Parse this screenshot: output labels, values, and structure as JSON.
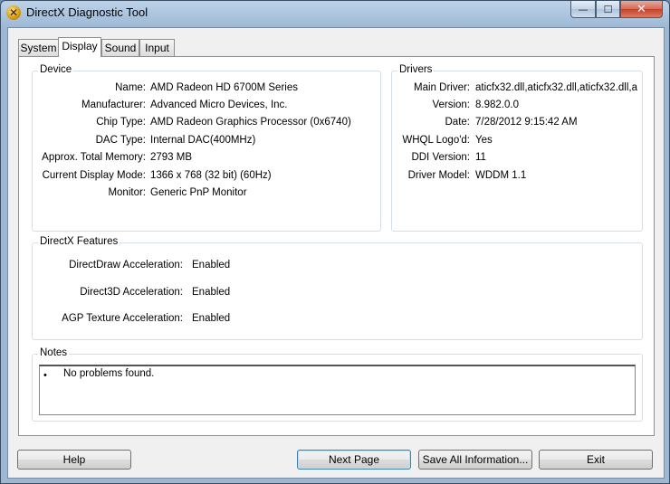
{
  "window": {
    "title": "DirectX Diagnostic Tool"
  },
  "tabs": [
    {
      "label": "System"
    },
    {
      "label": "Display"
    },
    {
      "label": "Sound"
    },
    {
      "label": "Input"
    }
  ],
  "active_tab": "Display",
  "device": {
    "title": "Device",
    "fields": [
      {
        "label": "Name:",
        "value": "AMD Radeon HD 6700M Series"
      },
      {
        "label": "Manufacturer:",
        "value": "Advanced Micro Devices, Inc."
      },
      {
        "label": "Chip Type:",
        "value": "AMD Radeon Graphics Processor (0x6740)"
      },
      {
        "label": "DAC Type:",
        "value": "Internal DAC(400MHz)"
      },
      {
        "label": "Approx. Total Memory:",
        "value": "2793 MB"
      },
      {
        "label": "Current Display Mode:",
        "value": "1366 x 768 (32 bit) (60Hz)"
      },
      {
        "label": "Monitor:",
        "value": "Generic PnP Monitor"
      }
    ]
  },
  "drivers": {
    "title": "Drivers",
    "fields": [
      {
        "label": "Main Driver:",
        "value": "aticfx32.dll,aticfx32.dll,aticfx32.dll,a"
      },
      {
        "label": "Version:",
        "value": "8.982.0.0"
      },
      {
        "label": "Date:",
        "value": "7/28/2012 9:15:42 AM"
      },
      {
        "label": "WHQL Logo'd:",
        "value": "Yes"
      },
      {
        "label": "DDI Version:",
        "value": "11"
      },
      {
        "label": "Driver Model:",
        "value": "WDDM 1.1"
      }
    ]
  },
  "features": {
    "title": "DirectX Features",
    "fields": [
      {
        "label": "DirectDraw Acceleration:",
        "value": "Enabled"
      },
      {
        "label": "Direct3D Acceleration:",
        "value": "Enabled"
      },
      {
        "label": "AGP Texture Acceleration:",
        "value": "Enabled"
      }
    ]
  },
  "notes": {
    "title": "Notes",
    "bullet": "•",
    "items": [
      "No problems found."
    ]
  },
  "buttons": {
    "help": "Help",
    "next_page": "Next Page",
    "save_all": "Save All Information...",
    "exit": "Exit"
  },
  "window_controls": {
    "minimize_glyph": "—",
    "maximize_glyph": "☐",
    "close_glyph": "✕",
    "app_icon_glyph": "✕"
  }
}
